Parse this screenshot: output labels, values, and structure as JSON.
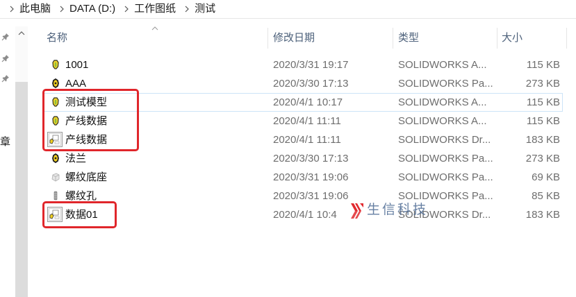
{
  "breadcrumb": {
    "items": [
      "此电脑",
      "DATA (D:)",
      "工作图纸",
      "测试"
    ],
    "separator_icon": "chevron-right-icon"
  },
  "nav_pane": {
    "pinned_icon": "pin-icon",
    "partial_item_label": "章"
  },
  "columns": {
    "name": "名称",
    "modified": "修改日期",
    "type": "类型",
    "size": "大小",
    "sort_icon": "sort-ascending-icon"
  },
  "files": [
    {
      "name": "1001",
      "modified": "2020/3/31 19:17",
      "type": "SOLIDWORKS A...",
      "size": "115 KB",
      "icon": "assembly-file-icon"
    },
    {
      "name": "AAA",
      "modified": "2020/3/30 17:13",
      "type": "SOLIDWORKS Pa...",
      "size": "273 KB",
      "icon": "part-file-icon"
    },
    {
      "name": "测试模型",
      "modified": "2020/4/1 10:17",
      "type": "SOLIDWORKS A...",
      "size": "115 KB",
      "icon": "assembly-file-icon",
      "focused": true
    },
    {
      "name": "产线数据",
      "modified": "2020/4/1 11:11",
      "type": "SOLIDWORKS A...",
      "size": "115 KB",
      "icon": "assembly-file-icon"
    },
    {
      "name": "产线数据",
      "modified": "2020/4/1 11:11",
      "type": "SOLIDWORKS Dr...",
      "size": "183 KB",
      "icon": "drawing-file-icon"
    },
    {
      "name": "法兰",
      "modified": "2020/3/30 17:13",
      "type": "SOLIDWORKS Pa...",
      "size": "273 KB",
      "icon": "part-file-icon"
    },
    {
      "name": "螺纹底座",
      "modified": "2020/3/31 19:06",
      "type": "SOLIDWORKS Pa...",
      "size": "69 KB",
      "icon": "part-thumbnail-icon"
    },
    {
      "name": "螺纹孔",
      "modified": "2020/3/31 19:06",
      "type": "SOLIDWORKS Pa...",
      "size": "85 KB",
      "icon": "bolt-thumbnail-icon"
    },
    {
      "name": "数据01",
      "modified": "2020/4/1 10:4",
      "type": "SOLIDWORKS Dr...",
      "size": "183 KB",
      "icon": "drawing-file-icon"
    }
  ],
  "watermark": {
    "text": "生信科技",
    "logo_icon": "watermark-logo-icon"
  },
  "colors": {
    "annotation_red": "#e0262b",
    "focus_border": "#cce4f7",
    "header_text": "#4c607a",
    "secondary_text": "#6d6d6d",
    "watermark_text": "#4d6b94",
    "watermark_logo": "#e12a2f"
  }
}
